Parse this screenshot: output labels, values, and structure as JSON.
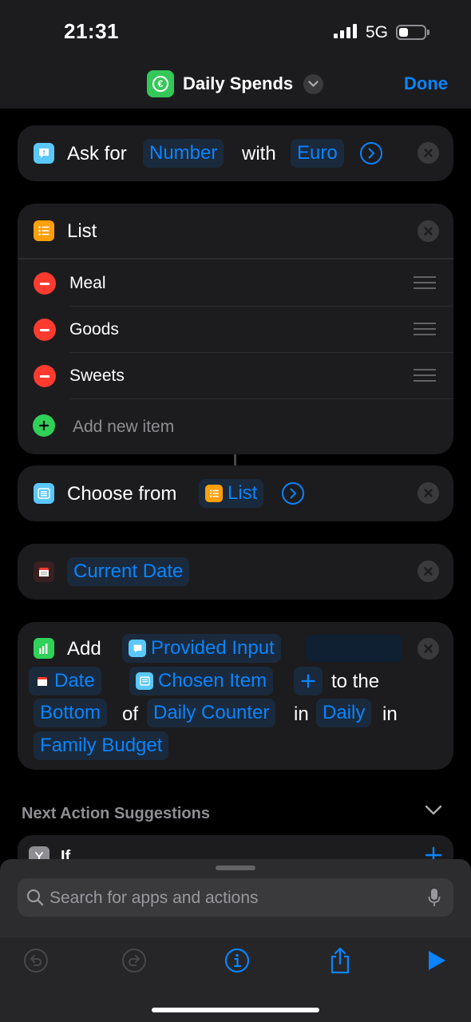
{
  "status_bar": {
    "time": "21:31",
    "network": "5G"
  },
  "nav": {
    "title": "Daily Spends",
    "done_label": "Done",
    "app_icon_glyph": "€"
  },
  "ask_card": {
    "label": "Ask for",
    "type_token": "Number",
    "with_label": "with",
    "currency_token": "Euro"
  },
  "list_card": {
    "title": "List",
    "items": [
      {
        "label": "Meal"
      },
      {
        "label": "Goods"
      },
      {
        "label": "Sweets"
      }
    ],
    "add_label": "Add new item"
  },
  "choose_card": {
    "label": "Choose from",
    "list_token": "List"
  },
  "date_card": {
    "token": "Current Date"
  },
  "add_card": {
    "add_label": "Add",
    "provided_input": "Provided Input",
    "date_token": "Date",
    "chosen_item": "Chosen Item",
    "plus": "+",
    "to_the": "to the",
    "position_token": "Bottom",
    "of_label": "of",
    "counter_token": "Daily Counter",
    "in_label": "in",
    "daily_token": "Daily",
    "in_label_2": "in",
    "budget_token": "Family Budget"
  },
  "suggestions": {
    "header": "Next Action Suggestions",
    "first_item": "If"
  },
  "search": {
    "placeholder": "Search for apps and actions"
  },
  "colors": {
    "accent": "#0a84ff",
    "card_bg": "#1c1c1e",
    "success": "#30d158",
    "destructive": "#ff3b30",
    "list_orange": "#ff9f0a",
    "ask_blue": "#5ac8fa"
  },
  "icons": [
    "euro-icon",
    "chevron-down-icon",
    "speech-bubble-icon",
    "list-icon",
    "calendar-icon",
    "chart-icon",
    "close-icon",
    "search-icon",
    "microphone-icon",
    "undo-icon",
    "redo-icon",
    "info-icon",
    "share-icon",
    "play-icon",
    "if-branch-icon"
  ]
}
